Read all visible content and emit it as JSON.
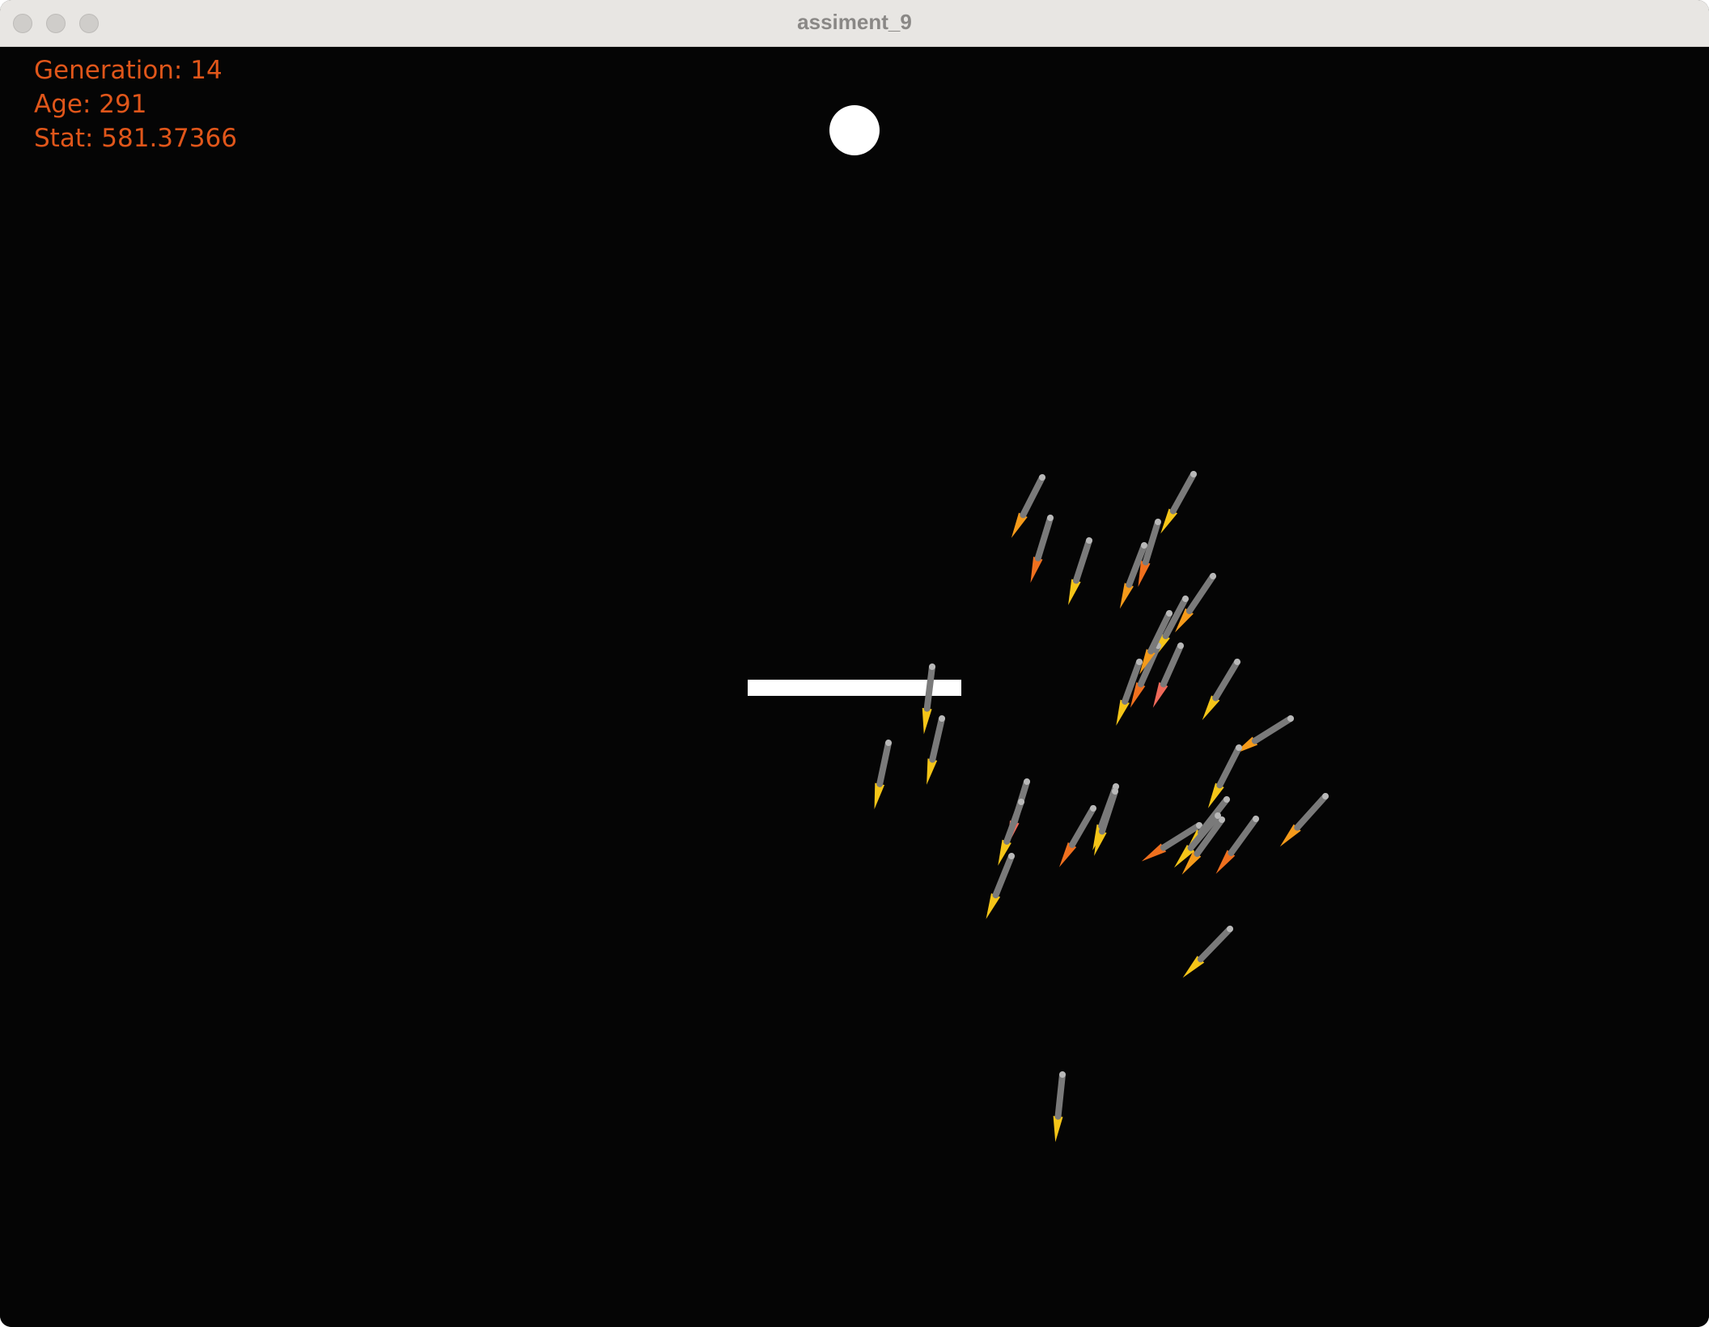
{
  "window": {
    "title": "assiment_9"
  },
  "hud": {
    "generation": "Generation: 14",
    "age": "Age: 291",
    "stat": "Stat: 581.37366",
    "color": "#e0561a"
  },
  "scene": {
    "background": "#050505",
    "target": {
      "name": "target-circle",
      "color": "#ffffff"
    },
    "obstacle": {
      "name": "obstacle-bar",
      "color": "#ffffff"
    },
    "rocket_count": 32,
    "flame_colors": [
      "#f5c518",
      "#f59a1a",
      "#f0701e",
      "#f06a5a"
    ]
  }
}
